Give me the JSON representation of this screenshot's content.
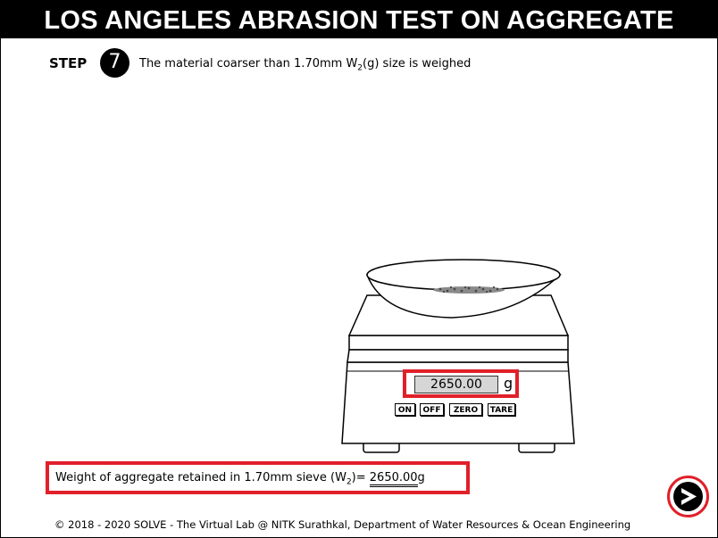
{
  "header": {
    "title": "LOS ANGELES ABRASION TEST ON AGGREGATE"
  },
  "step": {
    "label": "STEP",
    "number": "7",
    "text_before": "The material coarser than 1.70mm W",
    "text_sub": "2",
    "text_after": "(g) size is weighed"
  },
  "scale": {
    "reading": "2650.00",
    "unit": "g",
    "buttons": {
      "on": "ON",
      "off": "OFF",
      "zero": "ZERO",
      "tare": "TARE"
    }
  },
  "result": {
    "label_before": "Weight of aggregate retained in 1.70mm sieve (W",
    "label_sub": "2",
    "label_after": ")= ",
    "value": "2650.00",
    "unit": "g"
  },
  "navigation": {
    "next_icon": "next-arrow-icon"
  },
  "footer": {
    "text": "© 2018 - 2020 SOLVE - The Virtual Lab @ NITK Surathkal, Department of Water Resources & Ocean Engineering"
  },
  "colors": {
    "highlight": "#e0202a",
    "title_bg": "#000000",
    "display_bg": "#d6d6d6"
  }
}
